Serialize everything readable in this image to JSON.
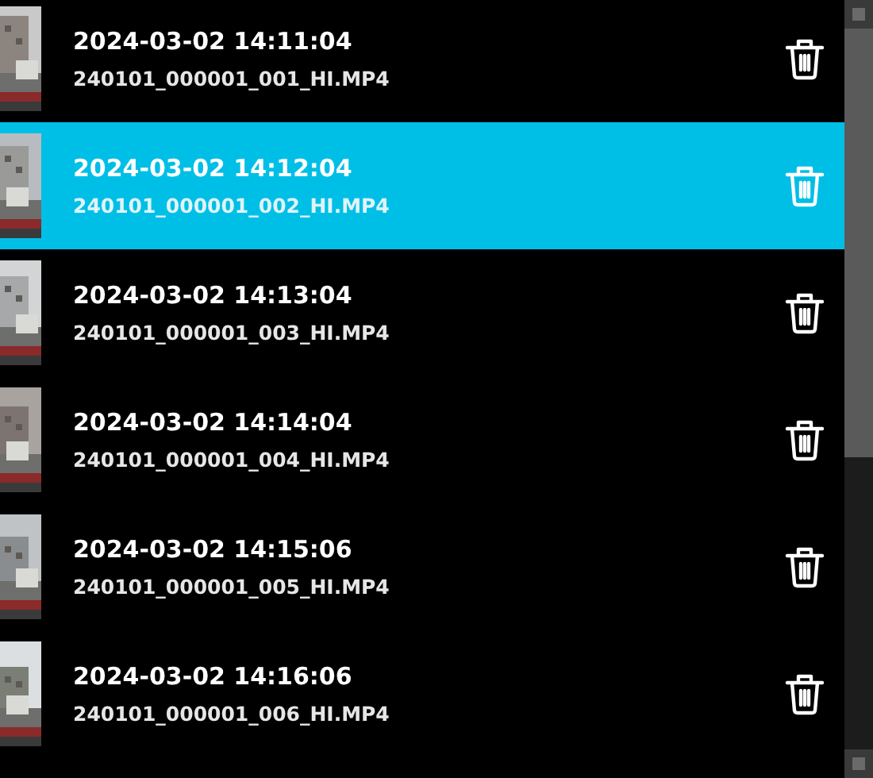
{
  "recordings": [
    {
      "timestamp": "2024-03-02 14:11:04",
      "filename": "240101_000001_001_HI.MP4",
      "selected": false
    },
    {
      "timestamp": "2024-03-02 14:12:04",
      "filename": "240101_000001_002_HI.MP4",
      "selected": true
    },
    {
      "timestamp": "2024-03-02 14:13:04",
      "filename": "240101_000001_003_HI.MP4",
      "selected": false
    },
    {
      "timestamp": "2024-03-02 14:14:04",
      "filename": "240101_000001_004_HI.MP4",
      "selected": false
    },
    {
      "timestamp": "2024-03-02 14:15:06",
      "filename": "240101_000001_005_HI.MP4",
      "selected": false
    },
    {
      "timestamp": "2024-03-02 14:16:06",
      "filename": "240101_000001_006_HI.MP4",
      "selected": false
    }
  ]
}
